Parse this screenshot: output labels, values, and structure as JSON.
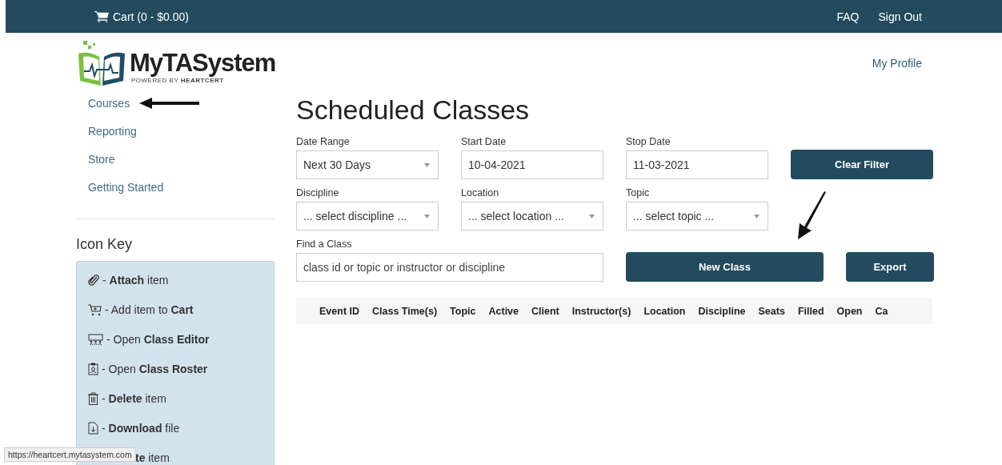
{
  "top_bar": {
    "cart": "Cart (0 - $0.00)",
    "links": [
      "FAQ",
      "Sign Out"
    ]
  },
  "logo": {
    "name": "My**TA**System",
    "tagline": "POWERED BY **HEARTCERT**"
  },
  "profile_link": "My Profile",
  "sidebar": {
    "items": [
      {
        "label": "Courses",
        "pointed": true
      },
      {
        "label": "Reporting",
        "pointed": false
      },
      {
        "label": "Store",
        "pointed": false
      },
      {
        "label": "Getting Started",
        "pointed": false
      }
    ],
    "icon_key": {
      "title": "Icon Key",
      "items": [
        {
          "kind": "attach",
          "text": "- **Attach** item"
        },
        {
          "kind": "cart",
          "text": "- Add item to **Cart**"
        },
        {
          "kind": "editor",
          "text": "- Open **Class Editor**"
        },
        {
          "kind": "roster",
          "text": "- Open **Class Roster**"
        },
        {
          "kind": "delete",
          "text": "- **Delete** item"
        },
        {
          "kind": "download",
          "text": "- **Download** file"
        },
        {
          "kind": "hidden",
          "text": "**te** item"
        }
      ]
    }
  },
  "page_title": "Scheduled Classes",
  "filters": [
    {
      "kind": "select",
      "label": "Date Range",
      "value": "Next 30 Days"
    },
    {
      "kind": "input",
      "label": "Start Date",
      "value": "10-04-2021"
    },
    {
      "kind": "input",
      "label": "Stop Date",
      "value": "11-03-2021"
    },
    {
      "kind": "select",
      "label": "Discipline",
      "value": "... select discipline ..."
    },
    {
      "kind": "select",
      "label": "Location",
      "value": "... select location ..."
    },
    {
      "kind": "select",
      "label": "Topic",
      "value": "... select topic ..."
    }
  ],
  "clear_button": "Clear Filter",
  "search": {
    "label": "Find a Class",
    "placeholder": "class id or topic or instructor or discipline"
  },
  "new_class_button": {
    "label": "New Class",
    "pointed": true
  },
  "export_button": "Export",
  "table": {
    "columns": [
      "Event ID",
      "Class Time(s)",
      "Topic",
      "Active",
      "Client",
      "Instructor(s)",
      "Location",
      "Discipline",
      "Seats",
      "Filled",
      "Open",
      "Ca"
    ]
  },
  "status_bar": "https://heartcert.mytasystem.com"
}
